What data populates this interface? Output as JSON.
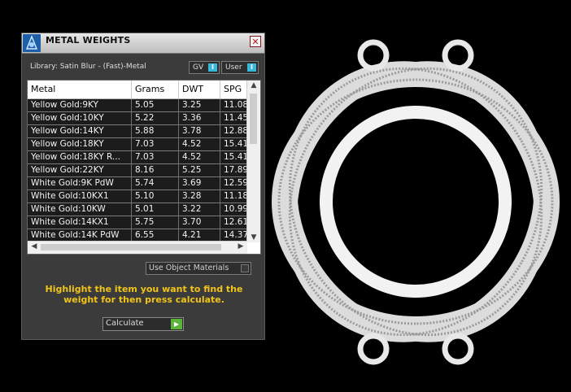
{
  "window": {
    "title": "METAL WEIGHTS",
    "close_glyph": "✕"
  },
  "library": "Library: Satin Blur - (Fast)-Metal",
  "toggles": [
    {
      "label": "GV",
      "state_glyph": "I"
    },
    {
      "label": "User",
      "state_glyph": "I"
    }
  ],
  "table": {
    "headers": [
      "Metal",
      "Grams",
      "DWT",
      "SPG"
    ],
    "rows": [
      [
        "Yellow Gold:9KY",
        "5.05",
        "3.25",
        "11.08"
      ],
      [
        "Yellow Gold:10KY",
        "5.22",
        "3.36",
        "11.45"
      ],
      [
        "Yellow Gold:14KY",
        "5.88",
        "3.78",
        "12.88"
      ],
      [
        "Yellow Gold:18KY",
        "7.03",
        "4.52",
        "15.41"
      ],
      [
        "Yellow Gold:18KY R...",
        "7.03",
        "4.52",
        "15.41"
      ],
      [
        "Yellow Gold:22KY",
        "8.16",
        "5.25",
        "17.89"
      ],
      [
        "White Gold:9K PdW",
        "5.74",
        "3.69",
        "12.59"
      ],
      [
        "White Gold:10KX1",
        "5.10",
        "3.28",
        "11.18"
      ],
      [
        "White Gold:10KW",
        "5.01",
        "3.22",
        "10.99"
      ],
      [
        "White Gold:14KX1",
        "5.75",
        "3.70",
        "12.61"
      ],
      [
        "White Gold:14K PdW",
        "6.55",
        "4.21",
        "14.37"
      ]
    ]
  },
  "use_object_materials": {
    "label": "Use Object Materials",
    "checked": false
  },
  "instructions": "Highlight the item you want to find the weight for then press calculate.",
  "calculate": {
    "label": "Calculate",
    "icon_glyph": "▶"
  },
  "colors": {
    "accent_text": "#f0c419",
    "row_bg": "#1c1c1c",
    "toggle_box": "#38b8d8",
    "calc_arrow": "#5cb33a"
  },
  "icons": [
    "app-icon",
    "close-icon",
    "scroll-up-icon",
    "scroll-down-icon",
    "scroll-left-icon",
    "scroll-right-icon",
    "calculate-arrow-icon"
  ]
}
